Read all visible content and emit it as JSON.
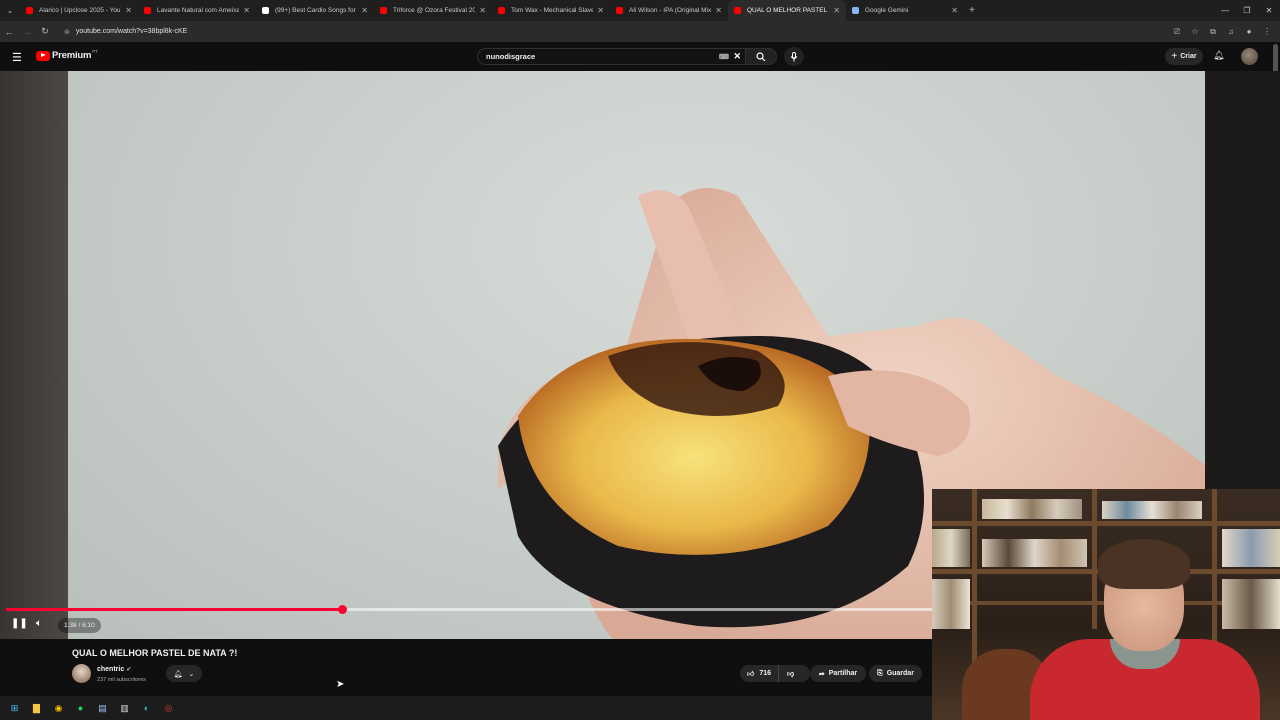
{
  "browser": {
    "tabs": [
      {
        "title": "Alarico | Upclose 2025 - YouTub",
        "favicon_color": "#ff0000",
        "active": false
      },
      {
        "title": "Lavante Natural com Ameixa -",
        "favicon_color": "#ff0000",
        "active": false
      },
      {
        "title": "(99+) Best Cardio Songs for Eff",
        "favicon_color": "#ffffff",
        "active": false
      },
      {
        "title": "Triforce @ Ozora Festival 2024",
        "favicon_color": "#ff0000",
        "active": false
      },
      {
        "title": "Tom Wax - Mechanical Slavery",
        "favicon_color": "#ff0000",
        "active": false
      },
      {
        "title": "Ali Wilson - IPA (Original Mix)",
        "favicon_color": "#ff0000",
        "active": false
      },
      {
        "title": "QUAL O MELHOR PASTEL D",
        "favicon_color": "#ff0000",
        "active": true
      },
      {
        "title": "Google Gemini",
        "favicon_color": "#8ab4f8",
        "active": false
      }
    ],
    "url": "youtube.com/watch?v=38bpl8k-cKE"
  },
  "youtube": {
    "logo_text": "Premium",
    "country_code": "PT",
    "search_value": "nunodisgrace",
    "create_label": "Criar"
  },
  "player": {
    "time_display": "1:38 / 6:10",
    "progress_fraction": 0.3624,
    "buffer_fraction": 1.0
  },
  "video": {
    "title": "QUAL O MELHOR PASTEL DE NATA ?!",
    "channel": "chentric",
    "subscribers": "237 mil subscritores",
    "likes": "716",
    "share_label": "Partilhar",
    "save_label": "Guardar"
  },
  "colors": {
    "accent": "#ff0033",
    "background": "#0f0f0f",
    "pill": "#272727"
  }
}
